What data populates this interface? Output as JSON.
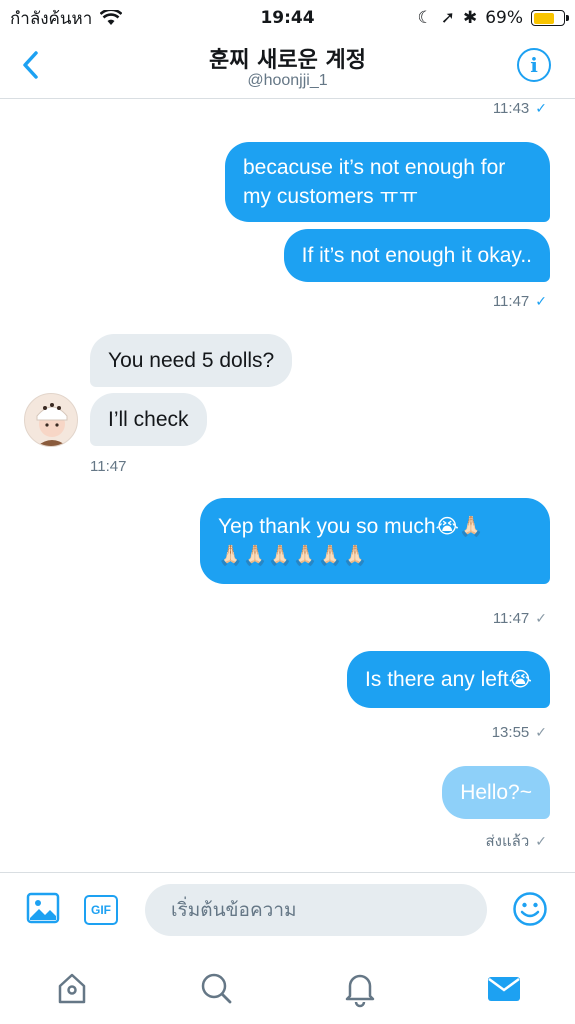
{
  "status": {
    "carrier": "กำลังค้นหา",
    "time": "19:44",
    "battery": "69%",
    "battery_level": 0.69
  },
  "header": {
    "title": "훈찌 새로운 계정",
    "handle": "@hoonjji_1"
  },
  "messages": {
    "ts1": "11:43",
    "out1": "becacuse it’s not enough for my customers ㅠㅠ",
    "out2": "If it’s not enough it okay..",
    "ts2": "11:47",
    "in1": "You need 5 dolls?",
    "in2": "I’ll check",
    "ts3": "11:47",
    "out3_text": "Yep thank you so much",
    "out3_emoji1": "😭🙏🏻",
    "out3_emoji2": "🙏🏻🙏🏻🙏🏻🙏🏻🙏🏻🙏🏻",
    "ts4": "11:47",
    "out4_text": "Is there any left",
    "out4_emoji": "😭",
    "ts5": "13:55",
    "out5": "Hello?~",
    "sent_label": "ส่งแล้ว"
  },
  "composer": {
    "placeholder": "เริ่มต้นข้อความ",
    "gif_label": "GIF"
  },
  "icons": {
    "back": "chevron-left-icon",
    "info": "info-icon",
    "image": "image-icon",
    "gif": "gif-icon",
    "emoji": "smiley-icon",
    "home": "home-icon",
    "search": "search-icon",
    "bell": "bell-icon",
    "mail": "mail-icon"
  },
  "colors": {
    "accent": "#1da1f2",
    "incoming_bubble": "#e6ecf0",
    "pending_bubble": "#8ed0f9"
  }
}
